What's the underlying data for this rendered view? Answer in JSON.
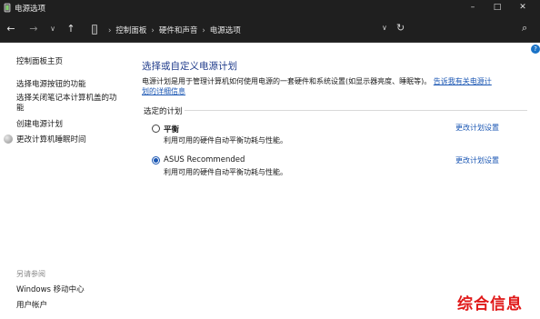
{
  "window": {
    "title": "电源选项",
    "controls": {
      "minimize": "–",
      "maximize": "□",
      "close": "✕"
    }
  },
  "nav": {
    "back": "←",
    "forward": "→",
    "recent": "∨",
    "up": "↑",
    "breadcrumb": [
      "控制面板",
      "硬件和声音",
      "电源选项"
    ],
    "separator": "›",
    "dropdown": "∨",
    "refresh": "↻",
    "search_icon": "⌕"
  },
  "sidebar": {
    "home": "控制面板主页",
    "items": [
      "选择电源按钮的功能",
      "选择关闭笔记本计算机盖的功",
      "能",
      "创建电源计划",
      "更改计算机睡眠时间"
    ],
    "see_also_label": "另请参阅",
    "see_also": [
      "Windows 移动中心",
      "用户帐户"
    ]
  },
  "main": {
    "heading": "选择或自定义电源计划",
    "description": "电源计划是用于管理计算机如何使用电源的一套硬件和系统设置(如显示器亮度、睡眠等)。",
    "description_link_1": "告诉我有关电源计",
    "description_link_2": "划的详细信息",
    "group_label": "选定的计划",
    "plans": [
      {
        "name": "平衡",
        "desc": "利用可用的硬件自动平衡功耗与性能。",
        "link": "更改计划设置",
        "selected": false
      },
      {
        "name": "ASUS Recommended",
        "desc": "利用可用的硬件自动平衡功耗与性能。",
        "link": "更改计划设置",
        "selected": true
      }
    ],
    "help": "?"
  },
  "watermark": "综合信息",
  "colors": {
    "titlebar": "#1f1f1f",
    "heading": "#1e3a8a",
    "link": "#1a56b3",
    "watermark": "#e01818"
  }
}
